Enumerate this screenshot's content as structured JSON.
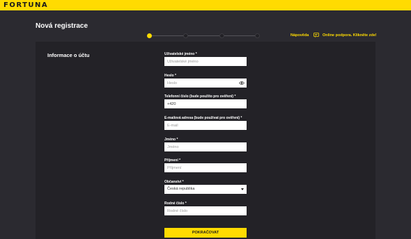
{
  "brand": {
    "logo_text": "FORTUNA",
    "accent": "#ffdb01"
  },
  "header": {
    "title": "Nová registrace",
    "steps": [
      {
        "active": true
      },
      {
        "active": false
      },
      {
        "active": false
      },
      {
        "active": false
      }
    ],
    "help_link": "Nápověda",
    "support_link": "Online podpora. Klikněte zde!",
    "support_icon": "chat-icon"
  },
  "form": {
    "section_title": "Informace o účtu",
    "username": {
      "label": "Uživatelské jméno *",
      "placeholder": "Uživatelské jméno",
      "value": ""
    },
    "password": {
      "label": "Heslo *",
      "placeholder": "Heslo",
      "value": "",
      "icon": "eye-icon"
    },
    "phone": {
      "label": "Telefonní číslo (bude použito pro ověření) *",
      "placeholder": "",
      "value": "+420"
    },
    "email": {
      "label": "E-mailová adresa (bude používat pro ověření) *",
      "placeholder": "E-mail",
      "value": ""
    },
    "first_name": {
      "label": "Jméno *",
      "placeholder": "Jméno",
      "value": ""
    },
    "last_name": {
      "label": "Příjmení *",
      "placeholder": "Příjmení",
      "value": ""
    },
    "citizenship": {
      "label": "Občanství *",
      "selected": "Česká republika"
    },
    "birth_number": {
      "label": "Rodné číslo *",
      "placeholder": "Rodné číslo",
      "value": ""
    },
    "continue_label": "POKRAČOVAT"
  }
}
